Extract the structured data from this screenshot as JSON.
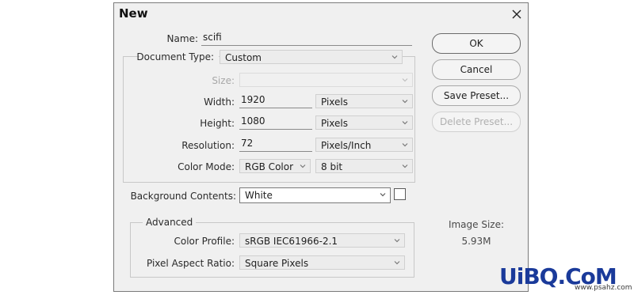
{
  "dialog": {
    "title": "New",
    "name_label": "Name:",
    "name_value": "scifi",
    "document_type_label": "Document Type:",
    "document_type_value": "Custom",
    "size_label": "Size:",
    "size_value": "",
    "width_label": "Width:",
    "width_value": "1920",
    "width_unit": "Pixels",
    "height_label": "Height:",
    "height_value": "1080",
    "height_unit": "Pixels",
    "resolution_label": "Resolution:",
    "resolution_value": "72",
    "resolution_unit": "Pixels/Inch",
    "color_mode_label": "Color Mode:",
    "color_mode_value": "RGB Color",
    "bit_depth_value": "8 bit",
    "background_label": "Background Contents:",
    "background_value": "White",
    "advanced_label": "Advanced",
    "color_profile_label": "Color Profile:",
    "color_profile_value": "sRGB IEC61966-2.1",
    "pixel_aspect_label": "Pixel Aspect Ratio:",
    "pixel_aspect_value": "Square Pixels"
  },
  "buttons": {
    "ok": "OK",
    "cancel": "Cancel",
    "save_preset": "Save Preset...",
    "delete_preset": "Delete Preset..."
  },
  "image_size": {
    "label": "Image Size:",
    "value": "5.93M"
  },
  "watermark": {
    "logo": "UiBQ.CoM",
    "site": "www.psahz.com"
  },
  "colors": {
    "dialog_bg": "#f0f0f0",
    "disabled_text": "#a8a8a8"
  }
}
